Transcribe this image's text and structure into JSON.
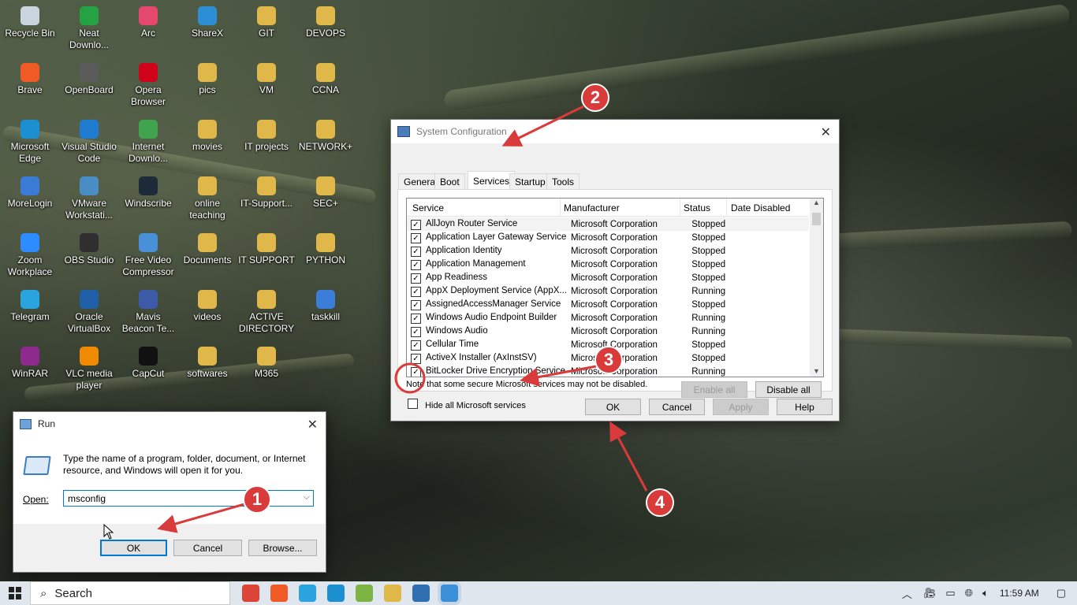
{
  "desktop": {
    "icons": [
      {
        "label": "Recycle Bin",
        "color": "#c9d4de"
      },
      {
        "label": "Neat Downlo...",
        "color": "#25a244"
      },
      {
        "label": "Arc",
        "color": "#e5486d"
      },
      {
        "label": "ShareX",
        "color": "#2c8fd6"
      },
      {
        "label": "GIT",
        "color": "#e0b84a"
      },
      {
        "label": "DEVOPS",
        "color": "#e0b84a"
      },
      {
        "label": "Brave",
        "color": "#f05a24"
      },
      {
        "label": "OpenBoard",
        "color": "#5b5b5b"
      },
      {
        "label": "Opera Browser",
        "color": "#d0021b"
      },
      {
        "label": "pics",
        "color": "#e0b84a"
      },
      {
        "label": "VM",
        "color": "#e0b84a"
      },
      {
        "label": "CCNA",
        "color": "#e0b84a"
      },
      {
        "label": "Microsoft Edge",
        "color": "#1b8fd0"
      },
      {
        "label": "Visual Studio Code",
        "color": "#1f7bd0"
      },
      {
        "label": "Internet Downlo...",
        "color": "#3fa34d"
      },
      {
        "label": "movies",
        "color": "#e0b84a"
      },
      {
        "label": "IT projects",
        "color": "#e0b84a"
      },
      {
        "label": "NETWORK+",
        "color": "#e0b84a"
      },
      {
        "label": "MoreLogin",
        "color": "#3a7bd5"
      },
      {
        "label": "VMware Workstati...",
        "color": "#4a8cc4"
      },
      {
        "label": "Windscribe",
        "color": "#1c2a3a"
      },
      {
        "label": "online teaching",
        "color": "#e0b84a"
      },
      {
        "label": "IT-Support...",
        "color": "#e0b84a"
      },
      {
        "label": "SEC+",
        "color": "#e0b84a"
      },
      {
        "label": "Zoom Workplace",
        "color": "#2d8cff"
      },
      {
        "label": "OBS Studio",
        "color": "#302e31"
      },
      {
        "label": "Free Video Compressor",
        "color": "#4a90d9"
      },
      {
        "label": "Documents",
        "color": "#e0b84a"
      },
      {
        "label": "IT SUPPORT",
        "color": "#e0b84a"
      },
      {
        "label": "PYTHON",
        "color": "#e0b84a"
      },
      {
        "label": "Telegram",
        "color": "#2aa3df"
      },
      {
        "label": "Oracle VirtualBox",
        "color": "#1f5fa8"
      },
      {
        "label": "Mavis Beacon Te...",
        "color": "#3d5aa8"
      },
      {
        "label": "videos",
        "color": "#e0b84a"
      },
      {
        "label": "ACTIVE DIRECTORY",
        "color": "#e0b84a"
      },
      {
        "label": "taskkill",
        "color": "#3b7dd8"
      },
      {
        "label": "WinRAR",
        "color": "#8e2a8e"
      },
      {
        "label": "VLC media player",
        "color": "#f08a00"
      },
      {
        "label": "CapCut",
        "color": "#111111"
      },
      {
        "label": "softwares",
        "color": "#e0b84a"
      },
      {
        "label": "M365",
        "color": "#e0b84a"
      }
    ]
  },
  "sysconfig": {
    "title": "System Configuration",
    "tabs": [
      "General",
      "Boot",
      "Services",
      "Startup",
      "Tools"
    ],
    "active_tab": "Services",
    "columns": [
      "Service",
      "Manufacturer",
      "Status",
      "Date Disabled"
    ],
    "rows": [
      {
        "name": "AllJoyn Router Service",
        "mfr": "Microsoft Corporation",
        "status": "Stopped"
      },
      {
        "name": "Application Layer Gateway Service",
        "mfr": "Microsoft Corporation",
        "status": "Stopped"
      },
      {
        "name": "Application Identity",
        "mfr": "Microsoft Corporation",
        "status": "Stopped"
      },
      {
        "name": "Application Management",
        "mfr": "Microsoft Corporation",
        "status": "Stopped"
      },
      {
        "name": "App Readiness",
        "mfr": "Microsoft Corporation",
        "status": "Stopped"
      },
      {
        "name": "AppX Deployment Service (AppX...",
        "mfr": "Microsoft Corporation",
        "status": "Running"
      },
      {
        "name": "AssignedAccessManager Service",
        "mfr": "Microsoft Corporation",
        "status": "Stopped"
      },
      {
        "name": "Windows Audio Endpoint Builder",
        "mfr": "Microsoft Corporation",
        "status": "Running"
      },
      {
        "name": "Windows Audio",
        "mfr": "Microsoft Corporation",
        "status": "Running"
      },
      {
        "name": "Cellular Time",
        "mfr": "Microsoft Corporation",
        "status": "Stopped"
      },
      {
        "name": "ActiveX Installer (AxInstSV)",
        "mfr": "Microsoft Corporation",
        "status": "Stopped"
      },
      {
        "name": "BitLocker Drive Encryption Service",
        "mfr": "Microsoft Corporation",
        "status": "Running"
      }
    ],
    "note": "Note that some secure Microsoft services may not be disabled.",
    "enable_all": "Enable all",
    "disable_all": "Disable all",
    "hide_ms_label": "Hide all Microsoft services",
    "ok": "OK",
    "cancel": "Cancel",
    "apply": "Apply",
    "help": "Help"
  },
  "run": {
    "title": "Run",
    "description": "Type the name of a program, folder, document, or Internet resource, and Windows will open it for you.",
    "open_label": "Open:",
    "value": "msconfig",
    "ok": "OK",
    "cancel": "Cancel",
    "browse": "Browse..."
  },
  "annotations": [
    "1",
    "2",
    "3",
    "4"
  ],
  "annotation_color": "#d93a3a",
  "taskbar": {
    "search_placeholder": "Search",
    "time": "11:59 AM",
    "apps": [
      {
        "name": "chrome-icon",
        "color": "#db4437"
      },
      {
        "name": "brave-icon",
        "color": "#f05a24"
      },
      {
        "name": "telegram-icon",
        "color": "#2aa3df"
      },
      {
        "name": "edge-icon",
        "color": "#1b8fd0"
      },
      {
        "name": "multicolor-app-icon",
        "color": "#7cb342"
      },
      {
        "name": "file-explorer-icon",
        "color": "#e0b84a"
      },
      {
        "name": "monitor-app-icon",
        "color": "#2f6fb0"
      },
      {
        "name": "run-app-icon",
        "color": "#3b8ed8"
      }
    ]
  }
}
